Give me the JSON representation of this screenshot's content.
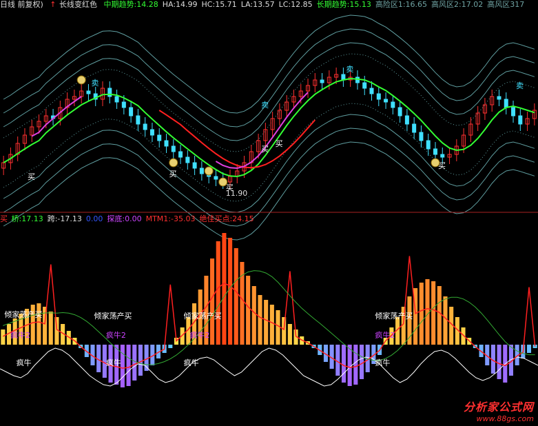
{
  "header_top": {
    "period": "日线 前复权)",
    "signal_text": "长线变红色",
    "items": [
      {
        "label": "中期趋势:",
        "value": "14.28",
        "color": "#33ff33"
      },
      {
        "label": "HA:",
        "value": "14.99",
        "color": "#dddddd"
      },
      {
        "label": "HC:",
        "value": "15.71",
        "color": "#dddddd"
      },
      {
        "label": "LA:",
        "value": "13.57",
        "color": "#dddddd"
      },
      {
        "label": "LC:",
        "value": "12.85",
        "color": "#dddddd"
      },
      {
        "label": "长期趋势:",
        "value": "15.13",
        "color": "#33ff33"
      },
      {
        "label": "高险区1:",
        "value": "16.65",
        "color": "#6fa3a3"
      },
      {
        "label": "高风区2:",
        "value": "17.02",
        "color": "#6fa3a3"
      },
      {
        "label": "高风区3",
        "value": "17",
        "color": "#6fa3a3"
      }
    ],
    "dash_marks": [
      "- -",
      "- -"
    ]
  },
  "header_bottom": {
    "prefix": "买",
    "items": [
      {
        "label": "桥:",
        "value": "17.13",
        "color": "#33ff33"
      },
      {
        "label": "跨:",
        "value": "-17.13",
        "color": "#dddddd"
      },
      {
        "label": "",
        "value": "0.00",
        "color": "#3355ff"
      },
      {
        "label": "探底:",
        "value": "0.00",
        "color": "#cc44ff"
      },
      {
        "label": "MTM1:",
        "value": "-35.03",
        "color": "#ff3030"
      },
      {
        "label": "绝佳买点:",
        "value": "24.15",
        "color": "#ff3030"
      }
    ]
  },
  "chart_data": [
    {
      "type": "candlestick",
      "title": "K线主图",
      "ylim": [
        11.0,
        18.0
      ],
      "candles_close": [
        12.6,
        12.9,
        13.3,
        13.6,
        13.9,
        14.1,
        14.3,
        14.2,
        14.6,
        14.9,
        15.0,
        15.2,
        15.1,
        14.9,
        15.3,
        15.0,
        14.8,
        14.6,
        14.3,
        14.0,
        13.8,
        13.6,
        13.4,
        13.2,
        13.0,
        12.8,
        12.6,
        12.4,
        12.2,
        12.1,
        12.0,
        11.9,
        12.1,
        12.3,
        12.6,
        13.0,
        13.4,
        13.8,
        14.2,
        14.5,
        14.8,
        15.0,
        15.2,
        15.4,
        15.6,
        15.5,
        15.7,
        15.8,
        15.6,
        15.7,
        15.5,
        15.3,
        15.1,
        14.9,
        14.8,
        14.6,
        14.3,
        14.0,
        13.7,
        13.4,
        13.1,
        12.9,
        12.8,
        12.9,
        13.2,
        13.6,
        14.0,
        14.4,
        14.7,
        15.0,
        14.9,
        14.6,
        14.3,
        14.0,
        14.2,
        14.5
      ],
      "annotations": [
        "买",
        "买",
        "买",
        "买",
        "买",
        "买",
        "11.90",
        "卖",
        "卖",
        "卖",
        "卖"
      ],
      "lines": [
        {
          "name": "中期趋势",
          "color": "#33ff33"
        },
        {
          "name": "长期趋势",
          "color": "#ff2020"
        },
        {
          "name": "趋势",
          "color": "#e040e0"
        }
      ]
    },
    {
      "type": "bar",
      "title": "副图指标",
      "ylim": [
        -75,
        170
      ],
      "bar_values": [
        22,
        30,
        38,
        45,
        52,
        58,
        60,
        55,
        48,
        40,
        30,
        20,
        10,
        -5,
        -18,
        -30,
        -40,
        -48,
        -55,
        -58,
        -62,
        -60,
        -52,
        -45,
        -38,
        -30,
        -20,
        -12,
        -5,
        10,
        25,
        40,
        60,
        80,
        100,
        125,
        150,
        162,
        155,
        140,
        120,
        100,
        85,
        72,
        65,
        58,
        50,
        40,
        30,
        22,
        12,
        5,
        -5,
        -15,
        -25,
        -35,
        -45,
        -55,
        -60,
        -58,
        -50,
        -40,
        -28,
        -15,
        10,
        25,
        40,
        55,
        70,
        82,
        90,
        95,
        92,
        85,
        70,
        55,
        40,
        25,
        10,
        -5,
        -18,
        -30,
        -42,
        -50,
        -55,
        -45,
        -30,
        -20,
        -12,
        -5
      ],
      "line_white": [
        -35,
        -40,
        -45,
        -48,
        -42,
        -30,
        -20,
        -10,
        -5,
        -8,
        -15,
        -25,
        -35,
        -45,
        -52,
        -58,
        -60,
        -55,
        -45,
        -35,
        -28,
        -30,
        -40,
        -50,
        -55,
        -52,
        -45,
        -35,
        -25,
        -20,
        -18,
        -22,
        -30,
        -38,
        -45,
        -40,
        -30,
        -20,
        -10,
        -5,
        -8,
        -15,
        -25,
        -35,
        -45,
        -50,
        -55,
        -60,
        -58,
        -50,
        -40,
        -30,
        -22,
        -18,
        -20,
        -28,
        -38,
        -48,
        -55,
        -50,
        -40,
        -28,
        -18,
        -10,
        -8,
        -12,
        -20,
        -30,
        -40,
        -48,
        -52,
        -48,
        -40,
        -30,
        -22,
        -18,
        -20,
        -25,
        -30
      ],
      "labels": [
        "倾家荡产买",
        "倾家荡产买",
        "倾家荡产买",
        "倾家荡产买",
        "疯牛",
        "疯牛",
        "疯牛",
        "疯牛",
        "疯牛2",
        "疯牛2",
        "疯牛2",
        "疯牛2"
      ],
      "lines": [
        {
          "name": "MTM1",
          "color": "#ff2020"
        },
        {
          "name": "桥",
          "color": "#33aa33"
        },
        {
          "name": "绝佳买点",
          "color": "#ffffff"
        }
      ]
    }
  ],
  "watermark": {
    "title": "分析家公式网",
    "url": "www.88gs.com"
  },
  "colors": {
    "bg": "#000000",
    "divider": "#aa2222",
    "band": "#5f9ea0",
    "up": "#ff3030",
    "down": "#40e0ff"
  }
}
